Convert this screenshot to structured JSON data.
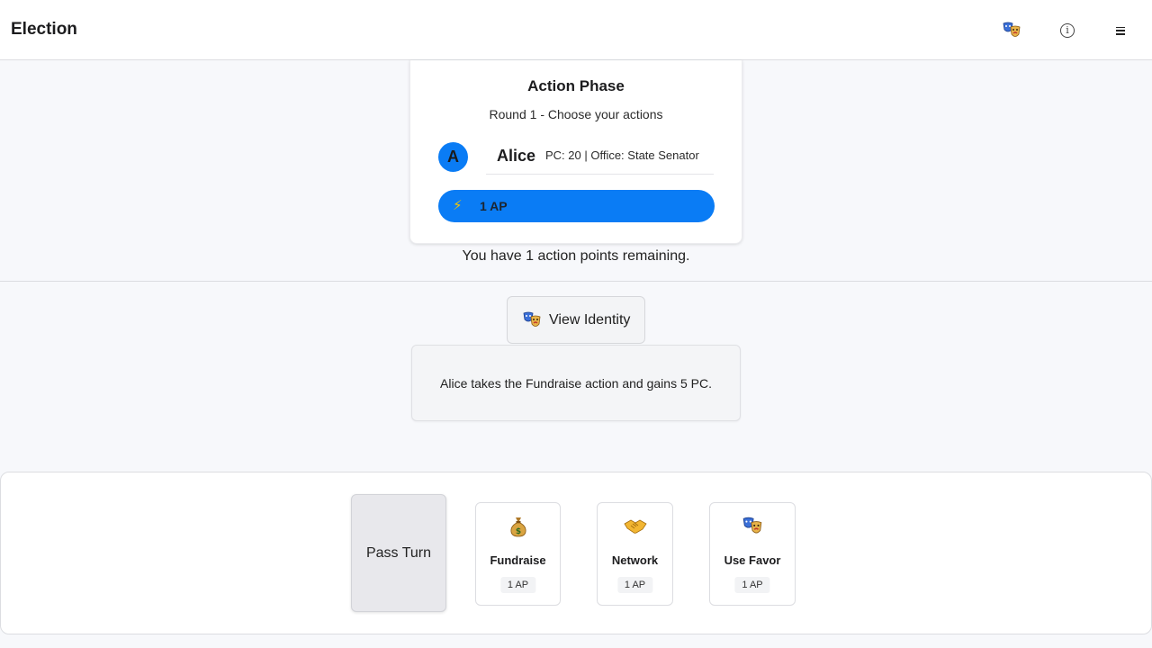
{
  "header": {
    "title": "Election",
    "icons": [
      "theater-masks-icon",
      "info-icon",
      "menu-icon"
    ]
  },
  "phase": {
    "title": "Action Phase",
    "subtitle": "Round 1 - Choose your actions",
    "player": {
      "initial": "A",
      "name": "Alice",
      "meta": "PC: 20 | Office: State Senator"
    },
    "ap_bar": {
      "icon": "lightning-icon",
      "label": "1 AP"
    },
    "remaining_text": "You have 1 action points remaining."
  },
  "view_identity": {
    "label": "View Identity",
    "icon": "theater-masks-icon"
  },
  "log": {
    "message": "Alice takes the Fundraise action and gains 5 PC."
  },
  "actions": {
    "pass_label": "Pass Turn",
    "cards": [
      {
        "icon": "money-bag-icon",
        "label": "Fundraise",
        "cost": "1 AP"
      },
      {
        "icon": "handshake-icon",
        "label": "Network",
        "cost": "1 AP"
      },
      {
        "icon": "theater-masks-icon",
        "label": "Use Favor",
        "cost": "1 AP"
      }
    ]
  },
  "colors": {
    "accent": "#0a7cf5",
    "background": "#f7f8fb",
    "pass_button": "#e8e8ec"
  }
}
